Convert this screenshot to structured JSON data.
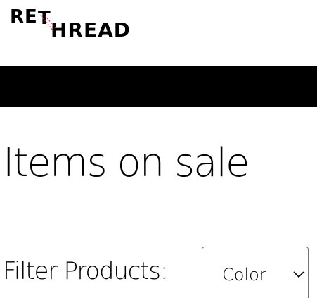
{
  "brand": {
    "logo_text": "RETHREAD"
  },
  "main": {
    "title": "Items on sale",
    "filter": {
      "label": "Filter Products:",
      "selected": "Color"
    }
  },
  "colors": {
    "navbar": "#000000",
    "text": "#000000",
    "logo_accent": "#e03030",
    "background": "#ffffff"
  }
}
